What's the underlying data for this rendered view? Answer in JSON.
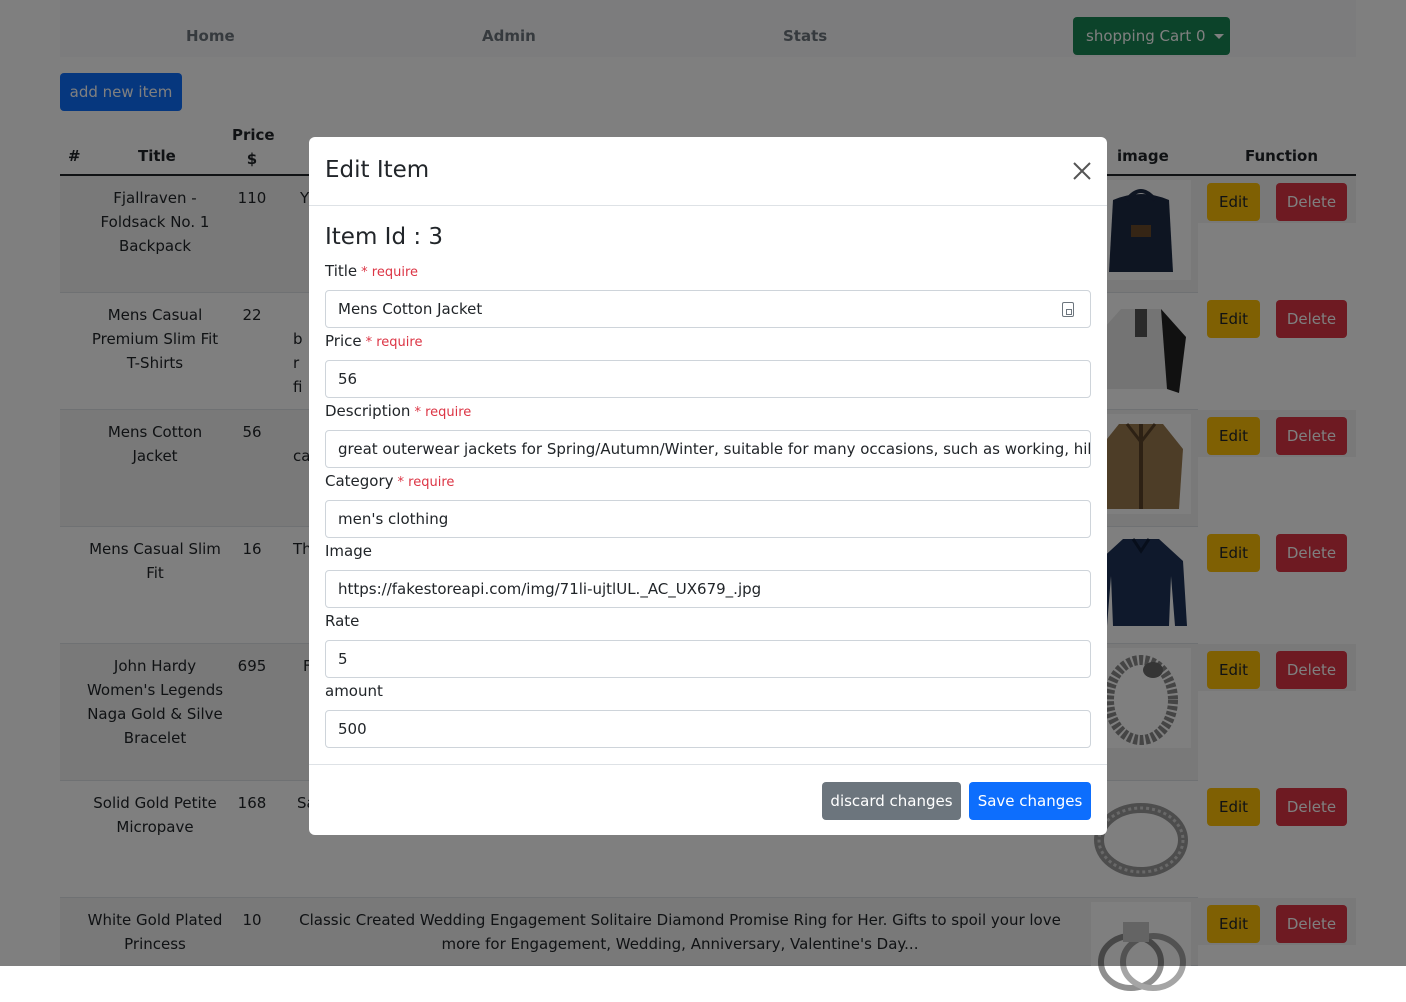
{
  "nav": {
    "home": "Home",
    "admin": "Admin",
    "stats": "Stats",
    "cart": "shopping Cart 0"
  },
  "toolbar": {
    "add_new_item": "add new item"
  },
  "table": {
    "headers": {
      "num": "#",
      "title": "Title",
      "price": "Price $",
      "image": "image",
      "function": "Function"
    },
    "rows": [
      {
        "title": "Fjallraven - Foldsack No. 1 Backpack",
        "price": "110",
        "description": "Y"
      },
      {
        "title": "Mens Casual Premium Slim Fit T-Shirts",
        "price": "22",
        "description": "br fi"
      },
      {
        "title": "Mens Cotton Jacket",
        "price": "56",
        "description": "ca"
      },
      {
        "title": "Mens Casual Slim Fit",
        "price": "16",
        "description": "Th"
      },
      {
        "title": "John Hardy Women's Legends Naga Gold & Silve Bracelet",
        "price": "695",
        "description": "F"
      },
      {
        "title": "Solid Gold Petite Micropave",
        "price": "168",
        "description": "Sa"
      },
      {
        "title": "White Gold Plated Princess",
        "price": "10",
        "description": "Classic Created Wedding Engagement Solitaire Diamond Promise Ring for Her. Gifts to spoil your love more for Engagement, Wedding, Anniversary, Valentine's Day..."
      }
    ],
    "edit_label": "Edit",
    "delete_label": "Delete"
  },
  "modal": {
    "title": "Edit Item",
    "item_id": "Item Id : 3",
    "required_marker": "* require",
    "fields": {
      "title_label": "Title",
      "title_value": "Mens Cotton Jacket",
      "price_label": "Price",
      "price_value": "56",
      "description_label": "Description",
      "description_value": "great outerwear jackets for Spring/Autumn/Winter, suitable for many occasions, such as working, hiking, c",
      "category_label": "Category",
      "category_value": "men's clothing",
      "image_label": "Image",
      "image_value": "https://fakestoreapi.com/img/71li-ujtlUL._AC_UX679_.jpg",
      "rate_label": "Rate",
      "rate_value": "5",
      "amount_label": "amount",
      "amount_value": "500"
    },
    "discard": "discard changes",
    "save": "Save changes"
  },
  "colors": {
    "primary": "#0d6efd",
    "success": "#198754",
    "warning": "#ffc107",
    "danger": "#dc3545",
    "secondary": "#6c757d"
  }
}
